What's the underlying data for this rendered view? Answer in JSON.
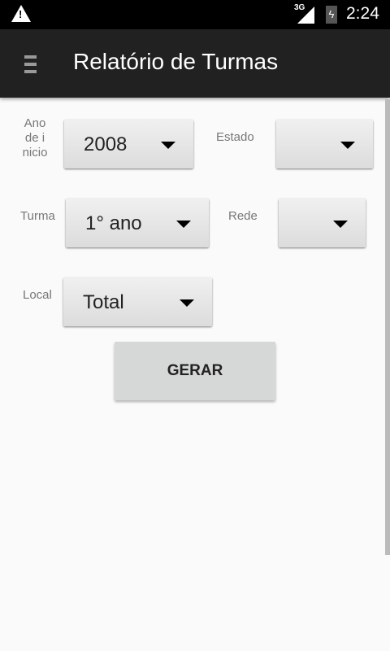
{
  "status_bar": {
    "network": "3G",
    "time": "2:24",
    "icons": [
      "warning-icon",
      "signal-icon",
      "battery-charging-icon"
    ]
  },
  "app_bar": {
    "title": "Relatório de Turmas",
    "menu_icon": "hamburger-icon"
  },
  "form": {
    "ano_label": "Ano de i nicio",
    "ano_value": "2008",
    "estado_label": "Estado",
    "estado_value": "",
    "turma_label": "Turma",
    "turma_value": "1° ano",
    "rede_label": "Rede",
    "rede_value": "",
    "local_label": "Local",
    "local_value": "Total",
    "submit_label": "GERAR"
  }
}
